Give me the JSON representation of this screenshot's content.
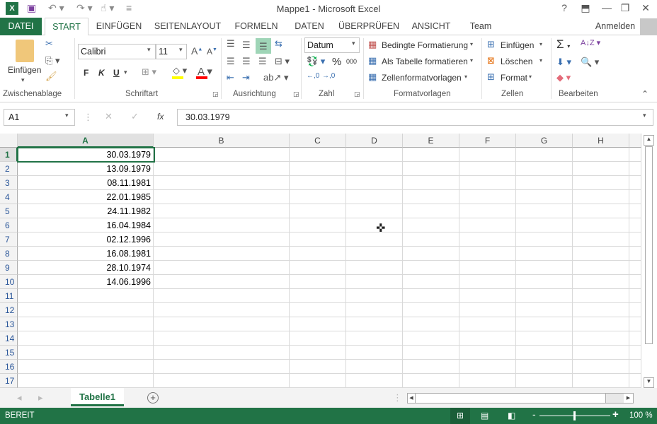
{
  "window": {
    "title": "Mappe1 - Microsoft Excel",
    "help": "?",
    "minimize": "—",
    "restore": "❐",
    "close": "✕"
  },
  "tabs": {
    "file": "DATEI",
    "items": [
      "START",
      "EINFÜGEN",
      "SEITENLAYOUT",
      "FORMELN",
      "DATEN",
      "ÜBERPRÜFEN",
      "ANSICHT",
      "Team"
    ],
    "signin": "Anmelden"
  },
  "ribbon": {
    "clipboard": {
      "paste": "Einfügen",
      "label": "Zwischenablage"
    },
    "font": {
      "name": "Calibri",
      "size": "11",
      "bold": "F",
      "italic": "K",
      "underline": "U",
      "label": "Schriftart"
    },
    "alignment": {
      "label": "Ausrichtung"
    },
    "number": {
      "format": "Datum",
      "percent": "%",
      "thousands": "000",
      "label": "Zahl"
    },
    "styles": {
      "conditional": "Bedingte Formatierung",
      "table": "Als Tabelle formatieren",
      "cellstyles": "Zellenformatvorlagen",
      "label": "Formatvorlagen"
    },
    "cells": {
      "insert": "Einfügen",
      "delete": "Löschen",
      "format": "Format",
      "label": "Zellen"
    },
    "editing": {
      "label": "Bearbeiten"
    }
  },
  "formula": {
    "namebox": "A1",
    "fx": "fx",
    "value": "30.03.1979"
  },
  "grid": {
    "columns": [
      "A",
      "B",
      "C",
      "D",
      "E",
      "F",
      "G",
      "H"
    ],
    "rows": [
      "1",
      "2",
      "3",
      "4",
      "5",
      "6",
      "7",
      "8",
      "9",
      "10",
      "11",
      "12",
      "13",
      "14",
      "15",
      "16",
      "17"
    ],
    "colA": [
      "30.03.1979",
      "13.09.1979",
      "08.11.1981",
      "22.01.1985",
      "24.11.1982",
      "16.04.1984",
      "02.12.1996",
      "16.08.1981",
      "28.10.1974",
      "14.06.1996"
    ]
  },
  "sheets": {
    "active": "Tabelle1"
  },
  "status": {
    "mode": "BEREIT",
    "zoom": "100 %",
    "zoom_level": 100
  },
  "colors": {
    "accent": "#217346"
  }
}
